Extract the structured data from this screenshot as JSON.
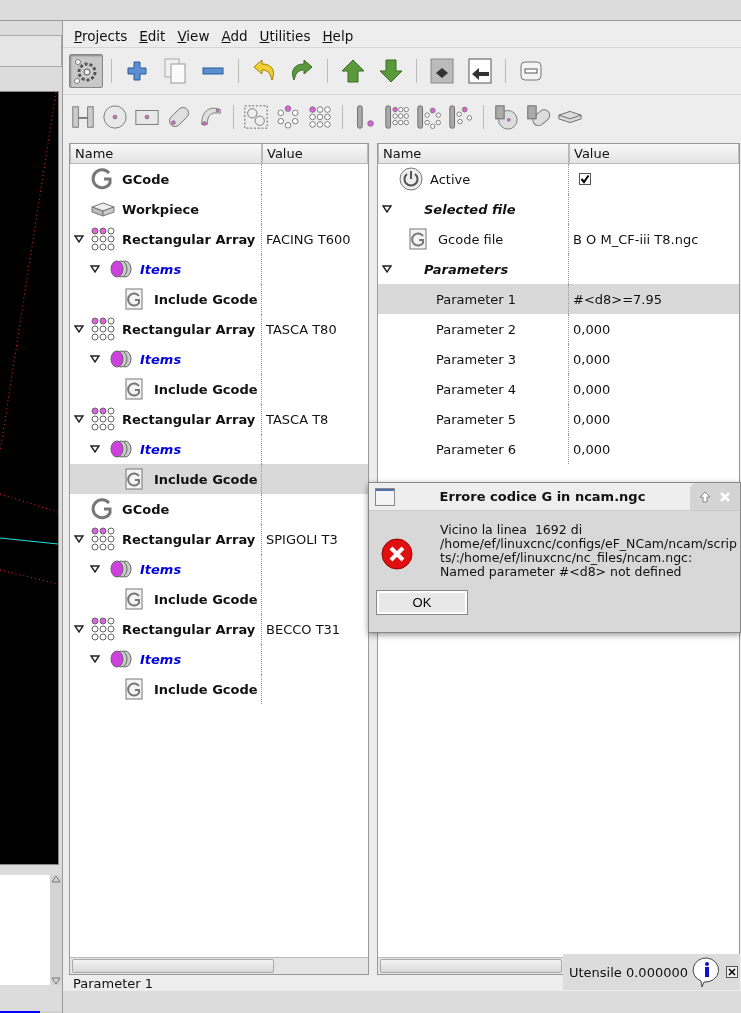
{
  "menu": [
    {
      "label": "Projects"
    },
    {
      "label": "Edit"
    },
    {
      "label": "View"
    },
    {
      "label": "Add"
    },
    {
      "label": "Utilities"
    },
    {
      "label": "Help"
    }
  ],
  "toolbar_top": [
    {
      "buttons": [
        {
          "kind": "settings",
          "pressed": true
        }
      ]
    },
    {
      "buttons": [
        {
          "kind": "add",
          "pressed": false
        },
        {
          "kind": "copy",
          "pressed": false
        },
        {
          "kind": "remove",
          "pressed": false
        }
      ]
    },
    {
      "buttons": [
        {
          "kind": "undo",
          "pressed": false
        },
        {
          "kind": "redo",
          "pressed": false
        }
      ]
    },
    {
      "buttons": [
        {
          "kind": "up",
          "pressed": false
        },
        {
          "kind": "down",
          "pressed": false
        }
      ]
    },
    {
      "buttons": [
        {
          "kind": "export",
          "pressed": false
        },
        {
          "kind": "import",
          "pressed": false
        }
      ]
    },
    {
      "buttons": [
        {
          "kind": "collapse",
          "pressed": false
        }
      ]
    }
  ],
  "toolbar_ops": [
    {
      "kind": "drill-pair"
    },
    {
      "kind": "circle"
    },
    {
      "kind": "rect"
    },
    {
      "kind": "slot"
    },
    {
      "kind": "arc-slot"
    },
    {
      "kind": "separator"
    },
    {
      "kind": "group"
    },
    {
      "kind": "ring"
    },
    {
      "kind": "grid"
    },
    {
      "kind": "separator"
    },
    {
      "kind": "mill"
    },
    {
      "kind": "mill-grid"
    },
    {
      "kind": "mill-ring"
    },
    {
      "kind": "mill-scatter"
    },
    {
      "kind": "separator"
    },
    {
      "kind": "bolt-circle"
    },
    {
      "kind": "bolt-slot"
    },
    {
      "kind": "plate"
    }
  ],
  "project_tree": {
    "columns": [
      "Name",
      "Value"
    ],
    "items": [
      {
        "kind": "gcode",
        "label": "GCode",
        "selected": false
      },
      {
        "kind": "workpiece",
        "label": "Workpiece",
        "selected": false
      },
      {
        "kind": "array",
        "label": "Rectangular Array",
        "value": "FACING T600",
        "selected": false,
        "expanded": true,
        "children": [
          {
            "kind": "items",
            "label": "Items",
            "selected": false,
            "expanded": true,
            "children": [
              {
                "kind": "include",
                "label": "Include Gcode",
                "selected": false
              }
            ]
          }
        ]
      },
      {
        "kind": "array",
        "label": "Rectangular Array",
        "value": "TASCA T80",
        "selected": false,
        "expanded": true,
        "children": [
          {
            "kind": "items",
            "label": "Items",
            "selected": false,
            "expanded": true,
            "children": [
              {
                "kind": "include",
                "label": "Include Gcode",
                "selected": false
              }
            ]
          }
        ]
      },
      {
        "kind": "array",
        "label": "Rectangular Array",
        "value": "TASCA T8",
        "selected": false,
        "expanded": true,
        "children": [
          {
            "kind": "items",
            "label": "Items",
            "selected": false,
            "expanded": true,
            "children": [
              {
                "kind": "include",
                "label": "Include Gcode",
                "selected": true
              }
            ]
          }
        ]
      },
      {
        "kind": "gcode",
        "label": "GCode",
        "selected": false
      },
      {
        "kind": "array",
        "label": "Rectangular Array",
        "value": "SPIGOLI T3",
        "selected": false,
        "expanded": true,
        "children": [
          {
            "kind": "items",
            "label": "Items",
            "selected": false,
            "expanded": true,
            "children": [
              {
                "kind": "include",
                "label": "Include Gcode",
                "selected": false
              }
            ]
          }
        ]
      },
      {
        "kind": "array",
        "label": "Rectangular Array",
        "value": "BECCO T31",
        "selected": false,
        "expanded": true,
        "children": [
          {
            "kind": "items",
            "label": "Items",
            "selected": false,
            "expanded": true,
            "children": [
              {
                "kind": "include",
                "label": "Include Gcode",
                "selected": false
              }
            ]
          }
        ]
      }
    ]
  },
  "properties": {
    "columns": [
      "Name",
      "Value"
    ],
    "items": [
      {
        "kind": "toggle",
        "label": "Active",
        "checked": true,
        "selected": false
      },
      {
        "kind": "group",
        "label": "Selected file",
        "selected": false,
        "expanded": true,
        "children": [
          {
            "kind": "file",
            "label": "Gcode file",
            "value": "B O M_CF-iii T8.ngc",
            "selected": false
          }
        ]
      },
      {
        "kind": "group",
        "label": "Parameters",
        "selected": false,
        "expanded": true,
        "children": [
          {
            "kind": "param",
            "label": "Parameter 1",
            "value": "#<d8>=7.95",
            "selected": true
          },
          {
            "kind": "param",
            "label": "Parameter 2",
            "value": "0,000",
            "selected": false
          },
          {
            "kind": "param",
            "label": "Parameter 3",
            "value": "0,000",
            "selected": false
          },
          {
            "kind": "param",
            "label": "Parameter 4",
            "value": "0,000",
            "selected": false
          },
          {
            "kind": "param",
            "label": "Parameter 5",
            "value": "0,000",
            "selected": false
          },
          {
            "kind": "param",
            "label": "Parameter 6",
            "value": "0,000",
            "selected": false
          }
        ]
      }
    ]
  },
  "status_bar": {
    "text": "Parameter 1",
    "tool": "Utensile 0.000000"
  },
  "background_progress": {
    "level": 0.65
  },
  "dialog": {
    "title": "Errore codice G in ncam.ngc",
    "message_lines": [
      "Vicino la linea  1692 di",
      "/home/ef/linuxcnc/configs/eF_NCam/ncam/scrip",
      "ts/:/home/ef/linuxcnc/nc_files/ncam.ngc:",
      "Named parameter #<d8> not defined"
    ],
    "button": "OK"
  }
}
